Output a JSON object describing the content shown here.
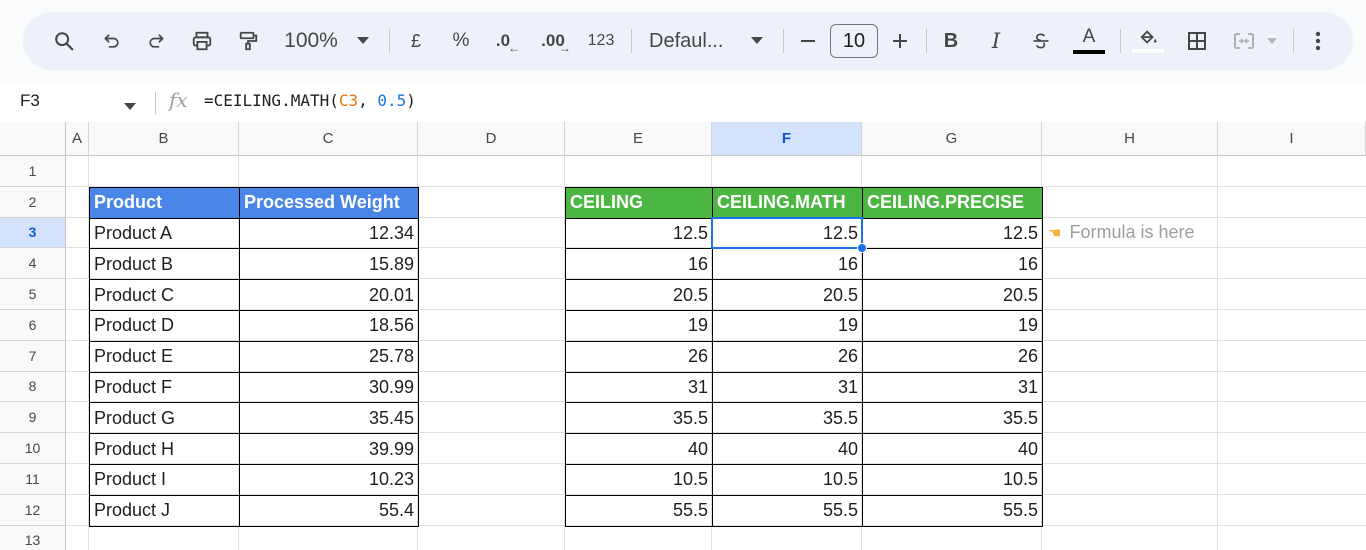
{
  "toolbar": {
    "zoom": "100%",
    "currency": "£",
    "percent": "%",
    "decrease_decimal": ".0",
    "increase_decimal": ".00",
    "number_format": "123",
    "font_name": "Defaul...",
    "font_size": "10",
    "bold": "B",
    "italic": "I",
    "text_color": "A",
    "icons": [
      "search-icon",
      "undo-icon",
      "redo-icon",
      "print-icon",
      "paint-format-icon",
      "chevron-down-icon",
      "minus-icon",
      "plus-icon",
      "strikethrough-icon",
      "fill-color-icon",
      "borders-icon",
      "merge-cells-icon",
      "more-vert-icon"
    ]
  },
  "formula_bar": {
    "name_box": "F3",
    "fx": "fx",
    "formula_prefix": "=CEILING.MATH(",
    "formula_ref": "C3",
    "formula_sep": ", ",
    "formula_num": "0.5",
    "formula_suffix": ")"
  },
  "columns": [
    "A",
    "B",
    "C",
    "D",
    "E",
    "F",
    "G",
    "H",
    "I"
  ],
  "rows": [
    "1",
    "2",
    "3",
    "4",
    "5",
    "6",
    "7",
    "8",
    "9",
    "10",
    "11",
    "12",
    "13"
  ],
  "selected": {
    "column": "F",
    "row": "3"
  },
  "table1": {
    "headers": [
      "Product",
      "Processed Weight"
    ],
    "rows": [
      [
        "Product A",
        "12.34"
      ],
      [
        "Product B",
        "15.89"
      ],
      [
        "Product C",
        "20.01"
      ],
      [
        "Product D",
        "18.56"
      ],
      [
        "Product E",
        "25.78"
      ],
      [
        "Product F",
        "30.99"
      ],
      [
        "Product G",
        "35.45"
      ],
      [
        "Product H",
        "39.99"
      ],
      [
        "Product I",
        "10.23"
      ],
      [
        "Product J",
        "55.4"
      ]
    ]
  },
  "table2": {
    "headers": [
      "CEILING",
      "CEILING.MATH",
      "CEILING.PRECISE"
    ],
    "rows": [
      [
        "12.5",
        "12.5",
        "12.5"
      ],
      [
        "16",
        "16",
        "16"
      ],
      [
        "20.5",
        "20.5",
        "20.5"
      ],
      [
        "19",
        "19",
        "19"
      ],
      [
        "26",
        "26",
        "26"
      ],
      [
        "31",
        "31",
        "31"
      ],
      [
        "35.5",
        "35.5",
        "35.5"
      ],
      [
        "40",
        "40",
        "40"
      ],
      [
        "10.5",
        "10.5",
        "10.5"
      ],
      [
        "55.5",
        "55.5",
        "55.5"
      ]
    ]
  },
  "note": {
    "icon": "pointing-hand-icon",
    "text": "Formula is here"
  },
  "colors": {
    "header_blue": "#4a86e8",
    "header_green": "#4cb643",
    "selection": "#1a73e8"
  }
}
